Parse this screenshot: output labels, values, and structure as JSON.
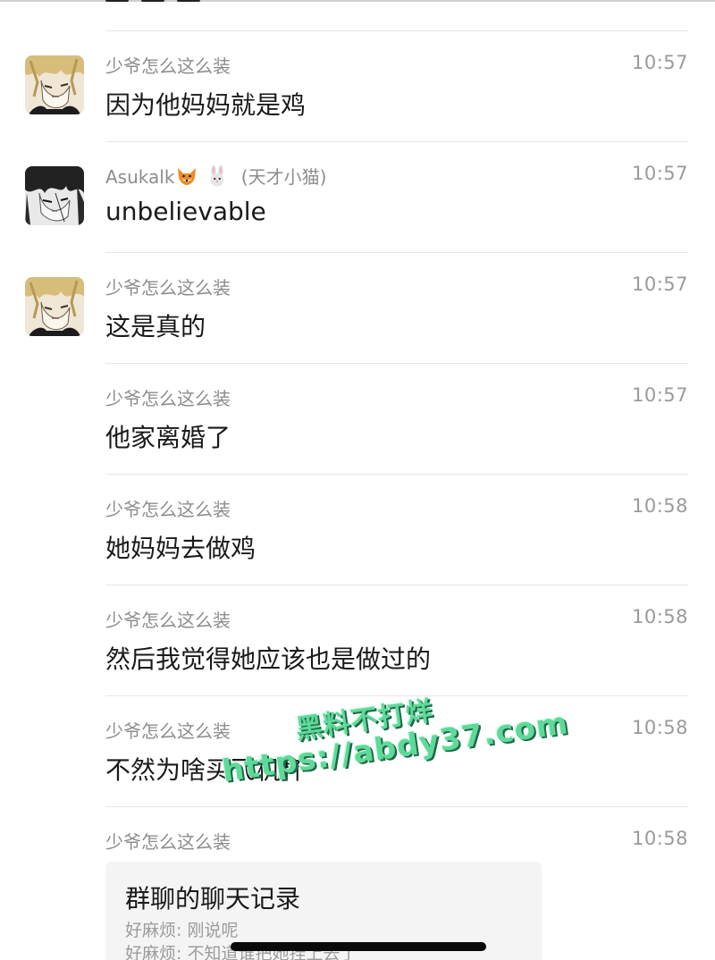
{
  "messages": [
    {
      "sender": "少爷怎么这么装",
      "time": "10:57",
      "text": "因为他妈妈就是鸡",
      "avatar": "blond-anime-avatar"
    },
    {
      "sender": "Asukalk",
      "sender_suffix": "(天才小猫)",
      "sender_emojis": [
        "fox-emoji",
        "rabbit-emoji"
      ],
      "time": "10:57",
      "text": "unbelievable",
      "avatar": "dark-anime-avatar"
    },
    {
      "sender": "少爷怎么这么装",
      "time": "10:57",
      "text": "这是真的",
      "avatar": "blond-anime-avatar"
    },
    {
      "sender": "少爷怎么这么装",
      "time": "10:57",
      "text": "他家离婚了"
    },
    {
      "sender": "少爷怎么这么装",
      "time": "10:58",
      "text": "她妈妈去做鸡"
    },
    {
      "sender": "少爷怎么这么装",
      "time": "10:58",
      "text": "然后我觉得她应该也是做过的"
    },
    {
      "sender": "少爷怎么这么装",
      "time": "10:58",
      "text": "不然为啥买飞机杯"
    },
    {
      "sender": "少爷怎么这么装",
      "time": "10:58"
    }
  ],
  "chat_record": {
    "title": "群聊的聊天记录",
    "lines": [
      "好麻烦: 刚说呢",
      "好麻烦: 不知道谁把她挂上去了"
    ]
  },
  "watermark": {
    "line1": "黑料不打烊",
    "line2": "https://abdy37.com"
  },
  "colors": {
    "sender": "#8d8d8d",
    "time": "#9a9a9a",
    "text": "#1a1a1a",
    "divider": "#e6e6e6",
    "card": "#f4f4f4",
    "watermark": "#5fd99a"
  }
}
